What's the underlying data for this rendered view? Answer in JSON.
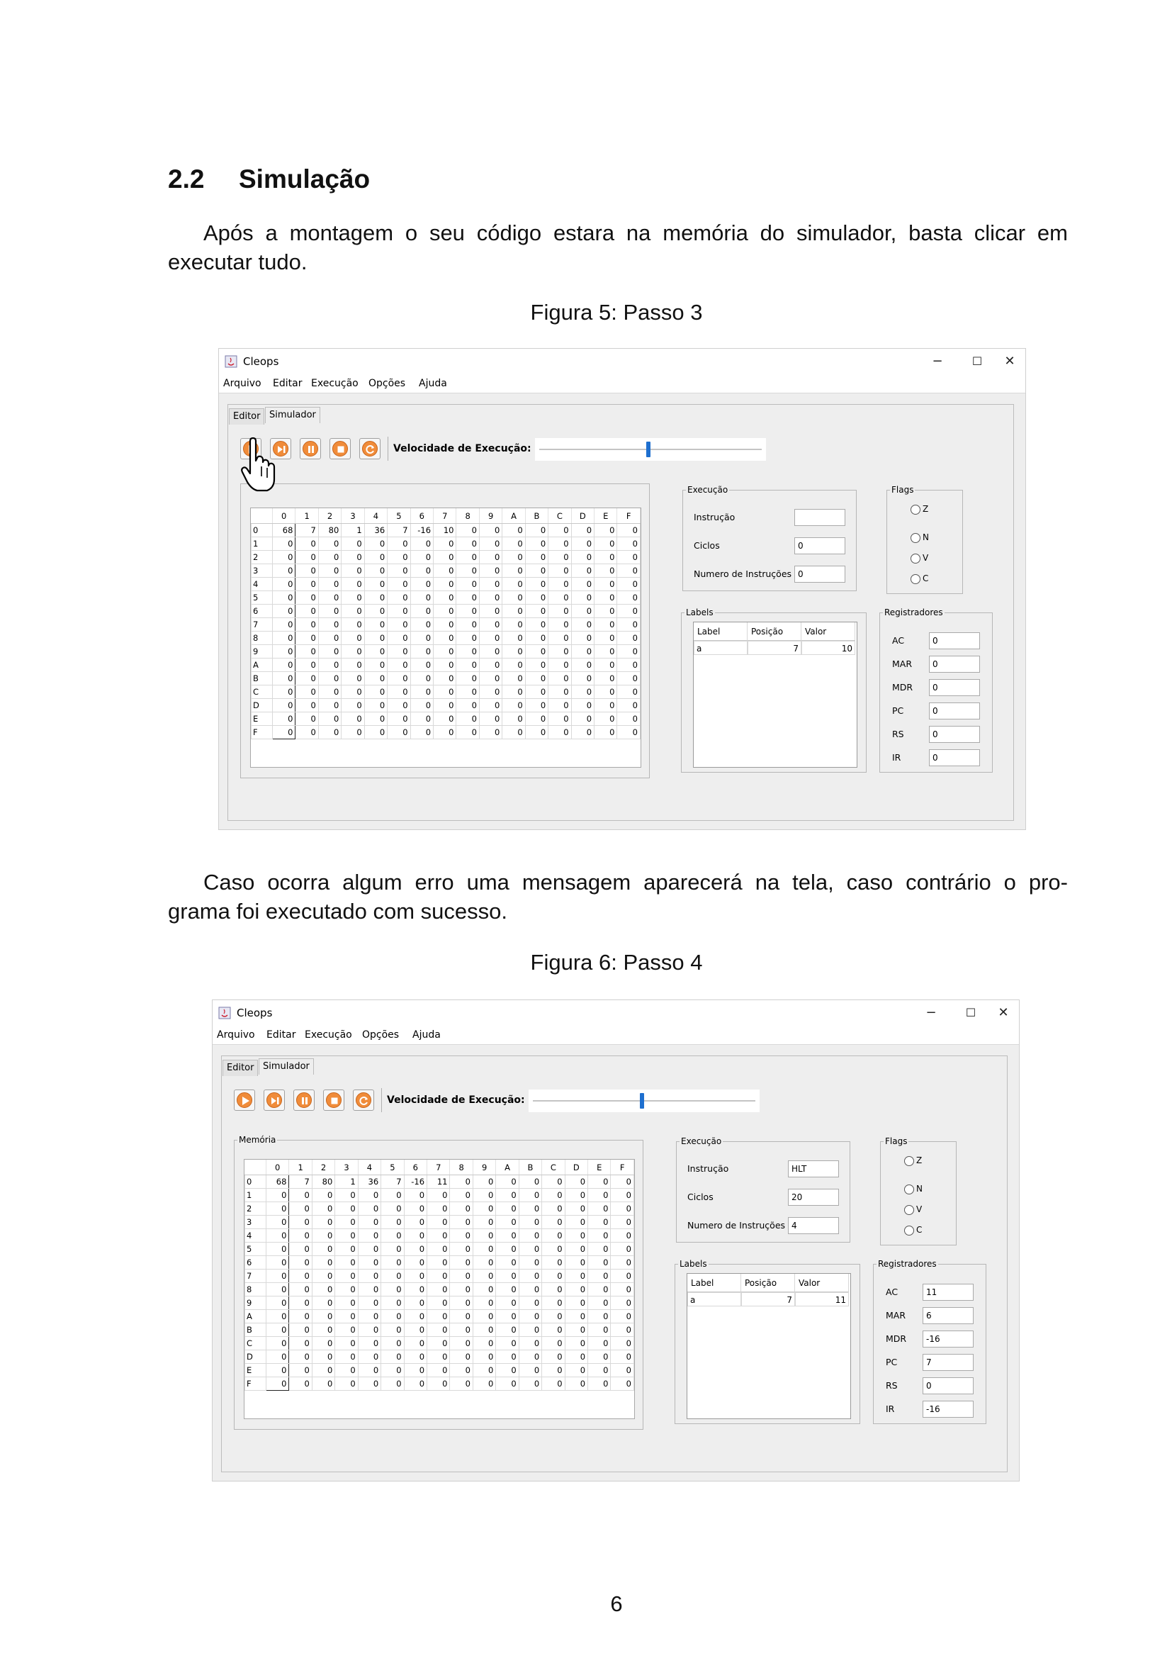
{
  "section": {
    "number": "2.2",
    "title": "Simulação"
  },
  "paragraph1": {
    "line1": "Após a montagem o seu código estara na memória do simulador, basta clicar em",
    "line2": "executar tudo."
  },
  "figure5_caption": "Figura 5: Passo 3",
  "paragraph2": {
    "line1": "Caso ocorra algum erro uma mensagem aparecerá na tela, caso contrário o pro-",
    "line2": "grama foi executado com sucesso."
  },
  "figure6_caption": "Figura 6: Passo 4",
  "page_number": "6",
  "app": {
    "title": "Cleops",
    "window_controls": {
      "minimize": "−",
      "maximize": "☐",
      "close": "✕"
    },
    "menu": [
      "Arquivo",
      "Editar",
      "Execução",
      "Opções",
      "Ajuda"
    ],
    "tabs": [
      "Editor",
      "Simulador"
    ],
    "toolbar_icons": [
      "run-all-icon",
      "step-icon",
      "pause-icon",
      "stop-icon",
      "reset-icon"
    ],
    "speed_label": "Velocidade de Execução:",
    "speed_value": 0.5,
    "accent_color": "#f08c3a",
    "slider_color": "#1e6fcf",
    "memory_legend": "Memória",
    "columns": [
      "0",
      "1",
      "2",
      "3",
      "4",
      "5",
      "6",
      "7",
      "8",
      "9",
      "A",
      "B",
      "C",
      "D",
      "E",
      "F"
    ],
    "rows": [
      "0",
      "1",
      "2",
      "3",
      "4",
      "5",
      "6",
      "7",
      "8",
      "9",
      "A",
      "B",
      "C",
      "D",
      "E",
      "F"
    ],
    "execucao_legend": "Execução",
    "execucao_labels": {
      "instrucao": "Instrução",
      "ciclos": "Ciclos",
      "numero": "Numero de Instruções"
    },
    "flags_legend": "Flags",
    "flags": [
      "Z",
      "N",
      "V",
      "C"
    ],
    "labels_legend": "Labels",
    "labels_headers": [
      "Label",
      "Posição",
      "Valor"
    ],
    "registradores_legend": "Registradores",
    "register_names": [
      "AC",
      "MAR",
      "MDR",
      "PC",
      "RS",
      "IR"
    ]
  },
  "figure5": {
    "memory_row0": [
      "68",
      "7",
      "80",
      "1",
      "36",
      "7",
      "-16",
      "10",
      "0",
      "0",
      "0",
      "0",
      "0",
      "0",
      "0",
      "0"
    ],
    "instrucao": "",
    "ciclos": "0",
    "numero_instrucoes": "0",
    "label_row": [
      "a",
      "7",
      "10"
    ],
    "registers": [
      "0",
      "0",
      "0",
      "0",
      "0",
      "0"
    ]
  },
  "figure6": {
    "memory_row0": [
      "68",
      "7",
      "80",
      "1",
      "36",
      "7",
      "-16",
      "11",
      "0",
      "0",
      "0",
      "0",
      "0",
      "0",
      "0",
      "0"
    ],
    "instrucao": "HLT",
    "ciclos": "20",
    "numero_instrucoes": "4",
    "label_row": [
      "a",
      "7",
      "11"
    ],
    "registers": [
      "11",
      "6",
      "-16",
      "7",
      "0",
      "-16"
    ]
  }
}
